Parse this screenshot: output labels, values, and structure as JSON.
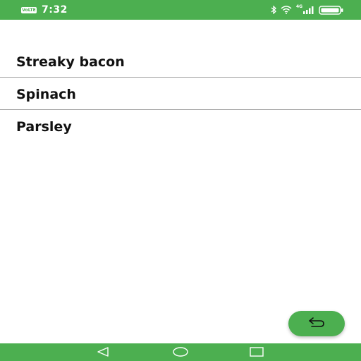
{
  "status_bar": {
    "volte": "VoLTE",
    "time": "7:32",
    "network": "4G",
    "icons": [
      "bluetooth-icon",
      "wifi-icon",
      "signal-icon",
      "battery-icon"
    ]
  },
  "items": [
    {
      "label": "Streaky bacon"
    },
    {
      "label": "Spinach"
    },
    {
      "label": "Parsley"
    }
  ],
  "fab": {
    "icon": "return-arrow-icon"
  },
  "nav": {
    "icons": [
      "back-triangle-icon",
      "home-circle-icon",
      "recents-square-icon"
    ]
  },
  "colors": {
    "accent": "#4caf50",
    "text": "#111111",
    "divider": "#9e9e9e",
    "background": "#ffffff"
  }
}
